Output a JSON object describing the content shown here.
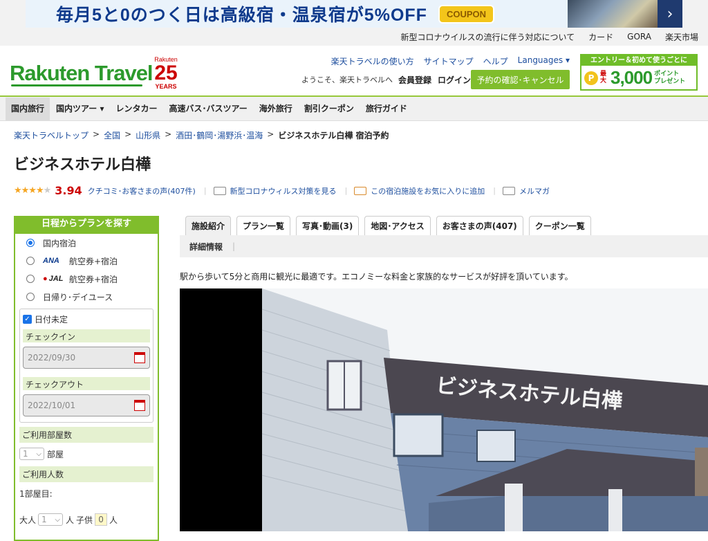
{
  "banner": {
    "text": "毎月5と0のつく日は高級宿・温泉宿が5%OFF",
    "coupon": "COUPON",
    "next": "›"
  },
  "util": [
    "新型コロナウイルスの流行に伴う対応について",
    "カード",
    "GORA",
    "楽天市場"
  ],
  "header": {
    "logo": "Rakuten Travel",
    "years": {
      "top": "Rakuten",
      "num": "25",
      "bottom": "YEARS"
    },
    "links": [
      "楽天トラベルの使い方",
      "サイトマップ",
      "ヘルプ",
      "Languages"
    ],
    "welcome": "ようこそ、楽天トラベルへ",
    "member": "会員登録",
    "login": "ログイン",
    "reserve_button": "予約の確認･キャンセル",
    "promo": {
      "top": "エントリー＆初めて使うごとに",
      "coin": "P",
      "max": "最大",
      "amount": "3,000",
      "pt1": "ポイント",
      "pt2": "プレゼント"
    }
  },
  "gnav": [
    {
      "label": "国内旅行",
      "active": true
    },
    {
      "label": "国内ツアー",
      "caret": true
    },
    {
      "label": "レンタカー"
    },
    {
      "label": "高速バス･バスツアー"
    },
    {
      "label": "海外旅行"
    },
    {
      "label": "割引クーポン"
    },
    {
      "label": "旅行ガイド"
    }
  ],
  "breadcrumb": [
    "楽天トラベルトップ",
    "全国",
    "山形県",
    "酒田･鶴岡･湯野浜･温海"
  ],
  "breadcrumb_sep": ">",
  "breadcrumb_current": "ビジネスホテル白樺 宿泊予約",
  "hotel": {
    "title": "ビジネスホテル白樺",
    "rating": 3.94,
    "rating_text": "3.94",
    "reviews_link": "クチコミ･お客さまの声(407件)",
    "covid_link": "新型コロナウィルス対策を見る",
    "fav_link": "この宿泊施設をお気に入りに追加",
    "mail_link": "メルマガ"
  },
  "sidebar": {
    "header": "日程からプランを探す",
    "options": [
      {
        "label": "国内宿泊",
        "selected": true,
        "brand": ""
      },
      {
        "label": "航空券+宿泊",
        "selected": false,
        "brand": "ANA"
      },
      {
        "label": "航空券+宿泊",
        "selected": false,
        "brand": "JAL"
      },
      {
        "label": "日帰り･デイユース",
        "selected": false,
        "brand": ""
      }
    ],
    "undecided": "日付未定",
    "checkin_label": "チェックイン",
    "checkin_value": "2022/09/30",
    "checkout_label": "チェックアウト",
    "checkout_value": "2022/10/01",
    "rooms_label": "ご利用部屋数",
    "rooms_value": "1",
    "rooms_unit": "部屋",
    "people_label": "ご利用人数",
    "room1_label": "1部屋目:",
    "adult_label": "大人",
    "adult_value": "1",
    "person_unit": "人",
    "child_label": "子供",
    "child_value": "0",
    "child_unit": "人"
  },
  "tabs": [
    "施設紹介",
    "プラン一覧",
    "写真･動画(3)",
    "地図･アクセス",
    "お客さまの声(407)",
    "クーポン一覧"
  ],
  "subtab": "詳細情報",
  "description": "駅から歩いて5分と商用に観光に最適です。エコノミーな料金と家族的なサービスが好評を頂いています。",
  "photo_sign": "ビジネスホテル白樺",
  "colors": {
    "green": "#80bd2c",
    "brand_green": "#2c9a2c",
    "link": "#1d4e9e",
    "score": "#cc0000"
  }
}
